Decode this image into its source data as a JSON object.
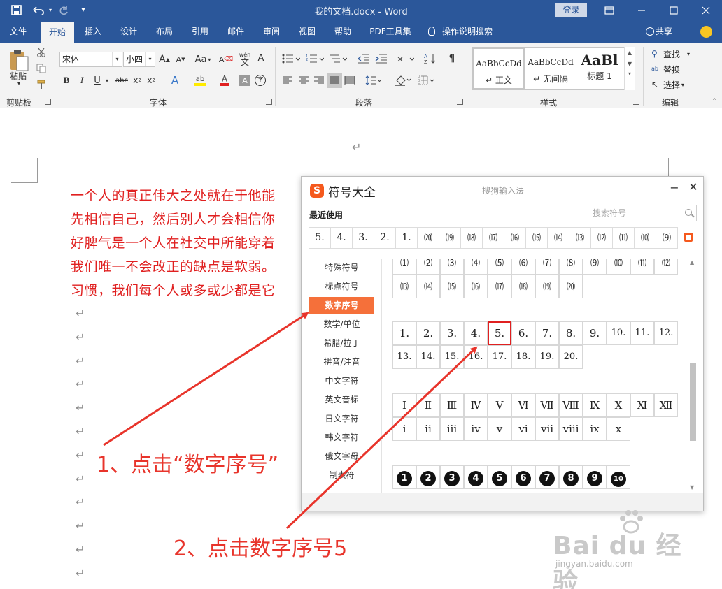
{
  "titlebar": {
    "title": "我的文档.docx  -  Word",
    "login_label": "登录",
    "qa_save": "save-icon",
    "qa_undo": "undo-icon",
    "qa_redo": "redo-icon"
  },
  "tabs": [
    {
      "label": "文件"
    },
    {
      "label": "开始"
    },
    {
      "label": "插入"
    },
    {
      "label": "设计"
    },
    {
      "label": "布局"
    },
    {
      "label": "引用"
    },
    {
      "label": "邮件"
    },
    {
      "label": "审阅"
    },
    {
      "label": "视图"
    },
    {
      "label": "帮助"
    },
    {
      "label": "PDF工具集"
    },
    {
      "label": "操作说明搜索"
    }
  ],
  "share_label": "共享",
  "ribbon": {
    "paste_label": "粘贴",
    "font_name": "宋体",
    "font_size": "小四",
    "aa_label": "Aa",
    "wen_label": "wén",
    "wen_char": "文",
    "a_char": "A",
    "styles": [
      {
        "preview": "AaBbCcDd",
        "name": "↵ 正文"
      },
      {
        "preview": "AaBbCcDd",
        "name": "↵ 无间隔"
      },
      {
        "preview": "AaBl",
        "name": "标题 1"
      }
    ],
    "find_label": "查找",
    "replace_label": "替换",
    "select_label": "选择",
    "groups": {
      "clipboard": "剪贴板",
      "font": "字体",
      "paragraph": "段落",
      "styles": "样式",
      "editing": "编辑"
    }
  },
  "document": {
    "top_mark": "↵",
    "lines": [
      "一个人的真正伟大之处就在于他能",
      "先相信自己，然后别人才会相信你",
      "好脾气是一个人在社交中所能穿着",
      "我们唯一不会改正的缺点是软弱。",
      "习惯，我们每个人或多或少都是它"
    ],
    "mark": "↵"
  },
  "dialog": {
    "logo": "S",
    "title": "符号大全",
    "ime_name": "搜狗输入法",
    "minimize": "−",
    "close": "✕",
    "recent_label": "最近使用",
    "search_placeholder": "搜索符号",
    "recent": [
      "5.",
      "4.",
      "3.",
      "2.",
      "1.",
      "⒇",
      "⒆",
      "⒅",
      "⒄",
      "⒃",
      "⒂",
      "⒁",
      "⒀",
      "⑿",
      "⑾",
      "⑽",
      "⑼"
    ],
    "categories": [
      {
        "label": "特殊符号",
        "active": false
      },
      {
        "label": "标点符号",
        "active": false
      },
      {
        "label": "数字序号",
        "active": true
      },
      {
        "label": "数学/单位",
        "active": false
      },
      {
        "label": "希腊/拉丁",
        "active": false
      },
      {
        "label": "拼音/注音",
        "active": false
      },
      {
        "label": "中文字符",
        "active": false
      },
      {
        "label": "英文音标",
        "active": false
      },
      {
        "label": "日文字符",
        "active": false
      },
      {
        "label": "韩文字符",
        "active": false
      },
      {
        "label": "俄文字母",
        "active": false
      },
      {
        "label": "制表符",
        "active": false
      }
    ],
    "paren_row1": [
      "⑴",
      "⑵",
      "⑶",
      "⑷",
      "⑸",
      "⑹",
      "⑺",
      "⑻",
      "⑼",
      "⑽",
      "⑾",
      "⑿"
    ],
    "paren_row2": [
      "⒀",
      "⒁",
      "⒂",
      "⒃",
      "⒄",
      "⒅",
      "⒆",
      "⒇"
    ],
    "dot_row1": [
      "1.",
      "2.",
      "3.",
      "4.",
      "5.",
      "6.",
      "7.",
      "8.",
      "9.",
      "10.",
      "11.",
      "12."
    ],
    "dot_row2": [
      "13.",
      "14.",
      "15.",
      "16.",
      "17.",
      "18.",
      "19.",
      "20."
    ],
    "roman_upper": [
      "Ⅰ",
      "Ⅱ",
      "Ⅲ",
      "Ⅳ",
      "Ⅴ",
      "Ⅵ",
      "Ⅶ",
      "Ⅷ",
      "Ⅸ",
      "Ⅹ",
      "Ⅺ",
      "Ⅻ"
    ],
    "roman_lower": [
      "ⅰ",
      "ⅱ",
      "ⅲ",
      "ⅳ",
      "ⅴ",
      "ⅵ",
      "ⅶ",
      "ⅷ",
      "ⅸ",
      "ⅹ"
    ],
    "circled": [
      "1",
      "2",
      "3",
      "4",
      "5",
      "6",
      "7",
      "8",
      "9",
      "10"
    ],
    "highlighted_symbol": "5."
  },
  "annotations": {
    "step1": "1、点击“数字序号”",
    "step2": "2、点击数字序号5",
    "color": "#e8342b"
  },
  "watermark": {
    "brand": "Bai  du 经验",
    "url": "jingyan.baidu.com"
  },
  "colors": {
    "word_blue": "#2b579a",
    "doc_text_red": "#e02020",
    "sogou_orange": "#f5703a"
  }
}
